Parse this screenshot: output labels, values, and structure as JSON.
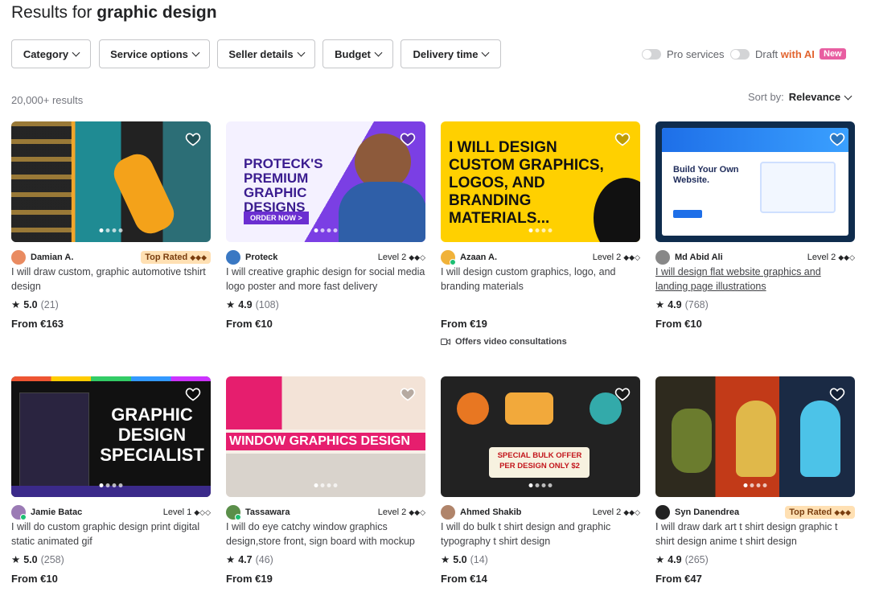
{
  "header": {
    "prefix": "Results for ",
    "query": "graphic design"
  },
  "filters": [
    {
      "label": "Category"
    },
    {
      "label": "Service options"
    },
    {
      "label": "Seller details"
    },
    {
      "label": "Budget"
    },
    {
      "label": "Delivery time"
    }
  ],
  "toggles": {
    "pro_label": "Pro services",
    "draft_label": "Draft ",
    "ai_label": "with AI",
    "new_badge": "New"
  },
  "results_count": "20,000+ results",
  "sort": {
    "label": "Sort by:",
    "value": "Relevance"
  },
  "gigs": [
    {
      "seller": "Damian A.",
      "level": "Top Rated",
      "level_marks": "◆◆◆",
      "top": true,
      "desc": "I will draw custom, graphic automotive tshirt design",
      "rating": "5.0",
      "reviews": "(21)",
      "price": "From €163",
      "theme": "#1a1a1a",
      "accent": "#f1a62b",
      "thumb_text": ""
    },
    {
      "seller": "Proteck",
      "level": "Level 2",
      "level_marks": "◆◆◇",
      "top": false,
      "desc": "I will creative graphic design for social media logo poster and more fast delivery",
      "rating": "4.9",
      "reviews": "(108)",
      "price": "From €10",
      "theme": "#6b3fd8",
      "accent": "#ffffff",
      "thumb_text": "PROTECK'S PREMIUM GRAPHIC DESIGNS"
    },
    {
      "seller": "Azaan A.",
      "level": "Level 2",
      "level_marks": "◆◆◇",
      "top": false,
      "desc": "I will design custom graphics, logo, and branding materials",
      "rating": "",
      "reviews": "",
      "price": "From €19",
      "video": "Offers video consultations",
      "theme": "#ffd000",
      "accent": "#111111",
      "thumb_text": "I WILL DESIGN CUSTOM GRAPHICS, LOGOS, AND BRANDING MATERIALS..."
    },
    {
      "seller": "Md Abid Ali",
      "level": "Level 2",
      "level_marks": "◆◆◇",
      "top": false,
      "desc": "I will design flat website graphics and landing page illustrations",
      "underline": true,
      "rating": "4.9",
      "reviews": "(768)",
      "price": "From €10",
      "theme": "#0f2c4d",
      "accent": "#1e6fe8",
      "thumb_text": "Build Your Own Website."
    },
    {
      "seller": "Jamie Batac",
      "level": "Level 1",
      "level_marks": "◆◇◇",
      "top": false,
      "desc": "I will do custom graphic design print digital static animated gif",
      "rating": "5.0",
      "reviews": "(258)",
      "price": "From €10",
      "theme": "#111111",
      "accent": "#ffffff",
      "thumb_text": "GRAPHIC DESIGN SPECIALIST"
    },
    {
      "seller": "Tassawara",
      "level": "Level 2",
      "level_marks": "◆◆◇",
      "top": false,
      "desc": "I will do eye catchy window graphics design,store front, sign board with mockup",
      "rating": "4.7",
      "reviews": "(46)",
      "price": "From €19",
      "theme": "#e61e6e",
      "accent": "#ffffff",
      "thumb_text": "WINDOW GRAPHICS DESIGN"
    },
    {
      "seller": "Ahmed Shakib",
      "level": "Level 2",
      "level_marks": "◆◆◇",
      "top": false,
      "desc": "I will do bulk t shirt design and graphic typography t shirt design",
      "rating": "5.0",
      "reviews": "(14)",
      "price": "From €14",
      "theme": "#222222",
      "accent": "#f2c100",
      "thumb_text": "SPECIAL BULK OFFER PER DESIGN ONLY $2"
    },
    {
      "seller": "Syn Danendrea",
      "level": "Top Rated",
      "level_marks": "◆◆◆",
      "top": true,
      "desc": "I will draw dark art t shirt design graphic t shirt design anime t shirt design",
      "rating": "4.9",
      "reviews": "(265)",
      "price": "From €47",
      "theme": "#c23a18",
      "accent": "#ffffff",
      "thumb_text": ""
    }
  ]
}
